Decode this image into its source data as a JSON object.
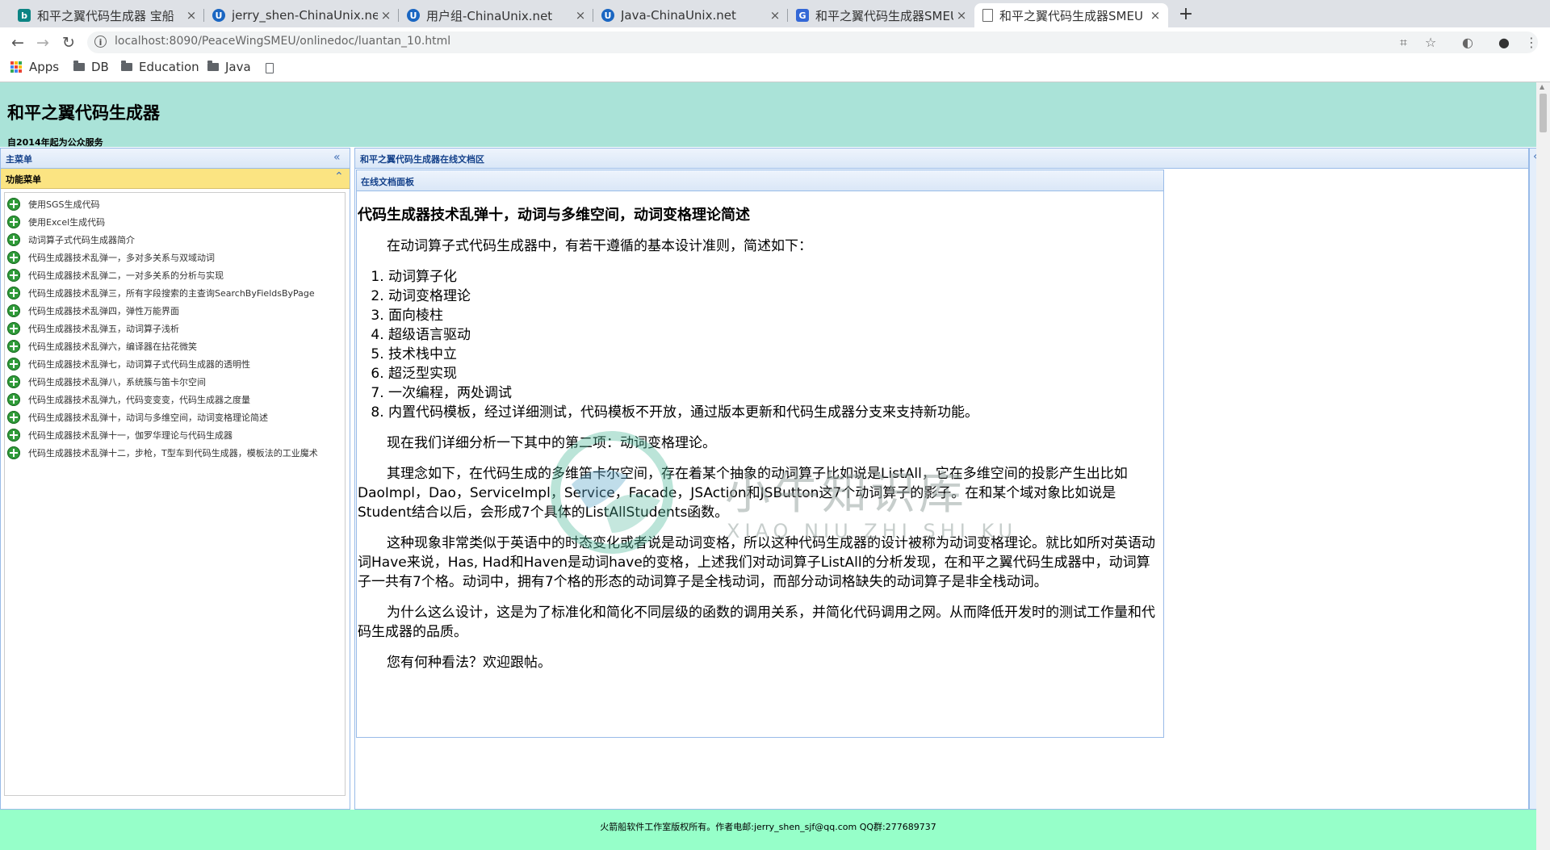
{
  "browser": {
    "tabs": [
      {
        "label": "和平之翼代码生成器 宝船",
        "icon": "bing-favicon",
        "close": "×"
      },
      {
        "label": "jerry_shen-ChinaUnix.net",
        "icon": "chinaunix-favicon",
        "close": "×"
      },
      {
        "label": "用户组-ChinaUnix.net",
        "icon": "chinaunix-favicon",
        "close": "×"
      },
      {
        "label": "Java-ChinaUnix.net",
        "icon": "chinaunix-favicon",
        "close": "×"
      },
      {
        "label": "和平之翼代码生成器SMEU",
        "icon": "page-favicon",
        "close": "×"
      },
      {
        "label": "和平之翼代码生成器SMEU",
        "icon": "blank-page-favicon",
        "close": "×"
      }
    ],
    "new_tab": "+",
    "url": "localhost:8090/PeaceWingSMEU/onlinedoc/luantan_10.html",
    "bookmarks": [
      {
        "label": "Apps",
        "icon": "apps-grid-icon"
      },
      {
        "label": "DB",
        "icon": "folder-icon"
      },
      {
        "label": "Education",
        "icon": "folder-icon"
      },
      {
        "label": "Java",
        "icon": "folder-icon"
      }
    ]
  },
  "header": {
    "title": "和平之翼代码生成器",
    "subtitle": "自2014年起为公众服务"
  },
  "west": {
    "title": "主菜单",
    "section_title": "功能菜单",
    "items": [
      "使用SGS生成代码",
      "使用Excel生成代码",
      "动词算子式代码生成器简介",
      "代码生成器技术乱弹一，多对多关系与双域动词",
      "代码生成器技术乱弹二，一对多关系的分析与实现",
      "代码生成器技术乱弹三，所有字段搜索的主查询SearchByFieldsByPage",
      "代码生成器技术乱弹四，弹性万能界面",
      "代码生成器技术乱弹五，动词算子浅析",
      "代码生成器技术乱弹六，编译器在拈花微笑",
      "代码生成器技术乱弹七，动词算子式代码生成器的透明性",
      "代码生成器技术乱弹八，系统簇与笛卡尔空间",
      "代码生成器技术乱弹九，代码变变变，代码生成器之度量",
      "代码生成器技术乱弹十，动词与多维空间，动词变格理论简述",
      "代码生成器技术乱弹十一，伽罗华理论与代码生成器",
      "代码生成器技术乱弹十二，步枪，T型车到代码生成器，模板法的工业魔术"
    ]
  },
  "center": {
    "title": "和平之翼代码生成器在线文档区",
    "panel_title": "在线文档面板",
    "article": {
      "title": "代码生成器技术乱弹十，动词与多维空间，动词变格理论简述",
      "intro": "在动词算子式代码生成器中，有若干遵循的基本设计准则，简述如下：",
      "principles": [
        "动词算子化",
        "动词变格理论",
        "面向棱柱",
        "超级语言驱动",
        "技术栈中立",
        "超泛型实现",
        "一次编程，两处调试",
        "内置代码模板，经过详细测试，代码模板不开放，通过版本更新和代码生成器分支来支持新功能。"
      ],
      "paragraphs": [
        "现在我们详细分析一下其中的第二项：动词变格理论。",
        "其理念如下，在代码生成的多维笛卡尔空间，存在着某个抽象的动词算子比如说是ListAll，它在多维空间的投影产生出比如DaoImpl，Dao，ServiceImpl，Service，Facade，JSAction和JSButton这7个动词算子的影子。在和某个域对象比如说是Student结合以后，会形成7个具体的ListAllStudents函数。",
        "这种现象非常类似于英语中的时态变化或者说是动词变格，所以这种代码生成器的设计被称为动词变格理论。就比如所对英语动词Have来说，Has, Had和Haven是动词have的变格，上述我们对动词算子ListAll的分析发现，在和平之翼代码生成器中，动词算子一共有7个格。动词中，拥有7个格的形态的动词算子是全栈动词，而部分动词格缺失的动词算子是非全栈动词。",
        "为什么这么设计，这是为了标准化和简化不同层级的函数的调用关系，并简化代码调用之网。从而降低开发时的测试工作量和代码生成器的品质。",
        "您有何种看法？欢迎跟帖。"
      ]
    }
  },
  "watermark": {
    "text": "小牛知识库",
    "sub": "XIAO NIU ZHI SHI KU"
  },
  "footer": {
    "text": "火箭船软件工作室版权所有。作者电邮:jerry_shen_sjf@qq.com QQ群:277689737"
  },
  "colors": {
    "header_bg": "#aae3d8",
    "footer_bg": "#96ffc9",
    "panel_border": "#99bbe8",
    "function_menu_bg": "#fbe482",
    "menu_icon": "#2f9b39"
  }
}
